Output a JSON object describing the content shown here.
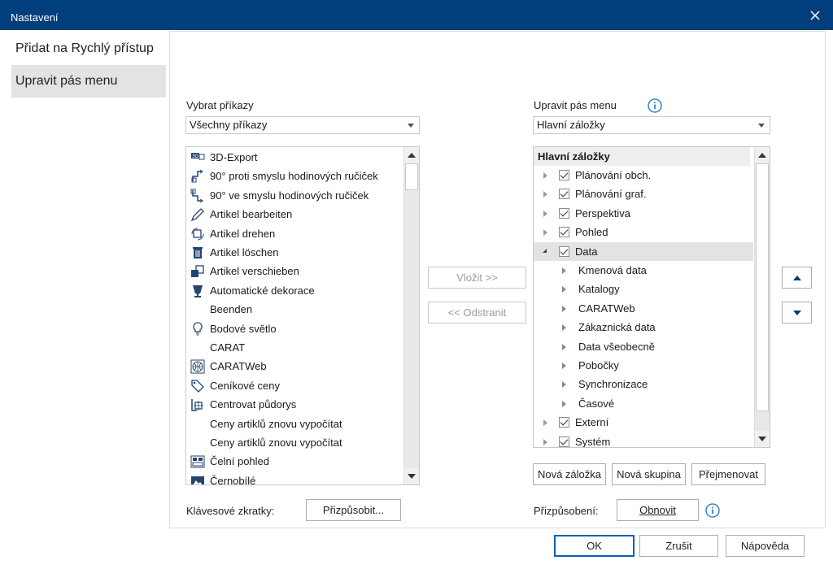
{
  "window": {
    "title": "Nastavení"
  },
  "nav": {
    "items": [
      {
        "label": "Přidat na Rychlý přístup",
        "selected": false
      },
      {
        "label": "Upravit pás menu",
        "selected": true
      }
    ]
  },
  "left": {
    "label": "Vybrat příkazy",
    "combo_value": "Všechny příkazy",
    "commands": [
      {
        "label": "3D-Export",
        "icon": "3d-export-icon"
      },
      {
        "label": "90° proti smyslu hodinových ručiček",
        "icon": "rotate-ccw-icon"
      },
      {
        "label": "90° ve smyslu hodinových ručiček",
        "icon": "rotate-cw-icon"
      },
      {
        "label": "Artikel bearbeiten",
        "icon": "pencil-icon"
      },
      {
        "label": "Artikel drehen",
        "icon": "rotate-article-icon"
      },
      {
        "label": "Artikel löschen",
        "icon": "trash-icon"
      },
      {
        "label": "Artikel verschieben",
        "icon": "move-article-icon"
      },
      {
        "label": "Automatické dekorace",
        "icon": "wine-glass-icon"
      },
      {
        "label": "Beenden",
        "icon": ""
      },
      {
        "label": "Bodové světlo",
        "icon": "bulb-icon"
      },
      {
        "label": "CARAT",
        "icon": ""
      },
      {
        "label": "CARATWeb",
        "icon": "globe-icon"
      },
      {
        "label": "Ceníkové ceny",
        "icon": "price-tag-icon"
      },
      {
        "label": "Centrovat půdorys",
        "icon": "center-plan-icon"
      },
      {
        "label": "Ceny artiklů znovu vypočítat",
        "icon": ""
      },
      {
        "label": "Ceny artiklů znovu vypočítat",
        "icon": ""
      },
      {
        "label": "Čelní pohled",
        "icon": "front-view-icon"
      },
      {
        "label": "Černobílé",
        "icon": "grayscale-icon"
      }
    ],
    "shortcuts_label": "Klávesové zkratky:",
    "customize_button": "Přizpůsobit..."
  },
  "middle": {
    "insert_button": "Vložit >>",
    "remove_button": "<< Odstranit"
  },
  "right": {
    "label": "Upravit pás menu",
    "combo_value": "Hlavní záložky",
    "tree_header": "Hlavní záložky",
    "tree": [
      {
        "label": "Plánování obch.",
        "level": 0,
        "checked": true,
        "expanded": false
      },
      {
        "label": "Plánování graf.",
        "level": 0,
        "checked": true,
        "expanded": false
      },
      {
        "label": "Perspektiva",
        "level": 0,
        "checked": true,
        "expanded": false
      },
      {
        "label": "Pohled",
        "level": 0,
        "checked": true,
        "expanded": false
      },
      {
        "label": "Data",
        "level": 0,
        "checked": true,
        "expanded": true,
        "selected": true
      },
      {
        "label": "Kmenová data",
        "level": 1
      },
      {
        "label": "Katalogy",
        "level": 1
      },
      {
        "label": "CARATWeb",
        "level": 1
      },
      {
        "label": "Zákaznická data",
        "level": 1
      },
      {
        "label": "Data všeobecně",
        "level": 1
      },
      {
        "label": "Pobočky",
        "level": 1
      },
      {
        "label": "Synchronizace",
        "level": 1
      },
      {
        "label": "Časové",
        "level": 1
      },
      {
        "label": "Externí",
        "level": 0,
        "checked": true,
        "expanded": false
      },
      {
        "label": "Systém",
        "level": 0,
        "checked": true,
        "expanded": false
      }
    ],
    "new_tab_button": "Nová záložka",
    "new_group_button": "Nová skupina",
    "rename_button": "Přejmenovat",
    "customization_label": "Přizpůsobení:",
    "restore_button": "Obnovit"
  },
  "footer": {
    "ok": "OK",
    "cancel": "Zrušit",
    "help": "Nápověda"
  },
  "colors": {
    "titlebar": "#003f7c",
    "selection": "#e3e3e3",
    "info_blue": "#1e6fc7"
  }
}
